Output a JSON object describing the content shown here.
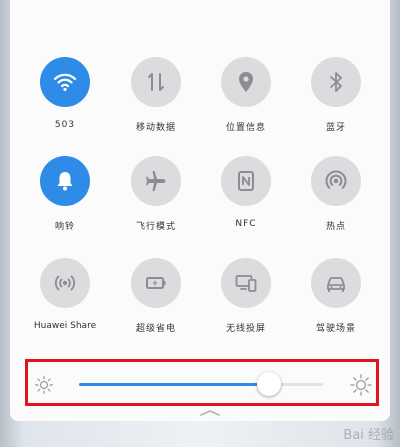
{
  "tiles": [
    {
      "label": "503",
      "icon": "wifi-icon",
      "active": true
    },
    {
      "label": "移动数据",
      "icon": "mobile-data-icon",
      "active": false
    },
    {
      "label": "位置信息",
      "icon": "location-pin-icon",
      "active": false
    },
    {
      "label": "蓝牙",
      "icon": "bluetooth-icon",
      "active": false
    },
    {
      "label": "响铃",
      "icon": "bell-icon",
      "active": true
    },
    {
      "label": "飞行模式",
      "icon": "airplane-icon",
      "active": false
    },
    {
      "label": "NFC",
      "icon": "nfc-icon",
      "active": false
    },
    {
      "label": "热点",
      "icon": "hotspot-icon",
      "active": false
    },
    {
      "label": "Huawei Share",
      "icon": "huawei-share-icon",
      "active": false
    },
    {
      "label": "超级省电",
      "icon": "battery-saver-icon",
      "active": false
    },
    {
      "label": "无线投屏",
      "icon": "wireless-projection-icon",
      "active": false
    },
    {
      "label": "驾驶场景",
      "icon": "car-icon",
      "active": false
    }
  ],
  "brightness": {
    "level": 0.78,
    "highlight_color": "#e0141c"
  },
  "colors": {
    "accent": "#2e8be8",
    "inactive_circle": "#dcdcdf",
    "icon_gray": "#8c8c92"
  },
  "watermark": "Bai 经验"
}
